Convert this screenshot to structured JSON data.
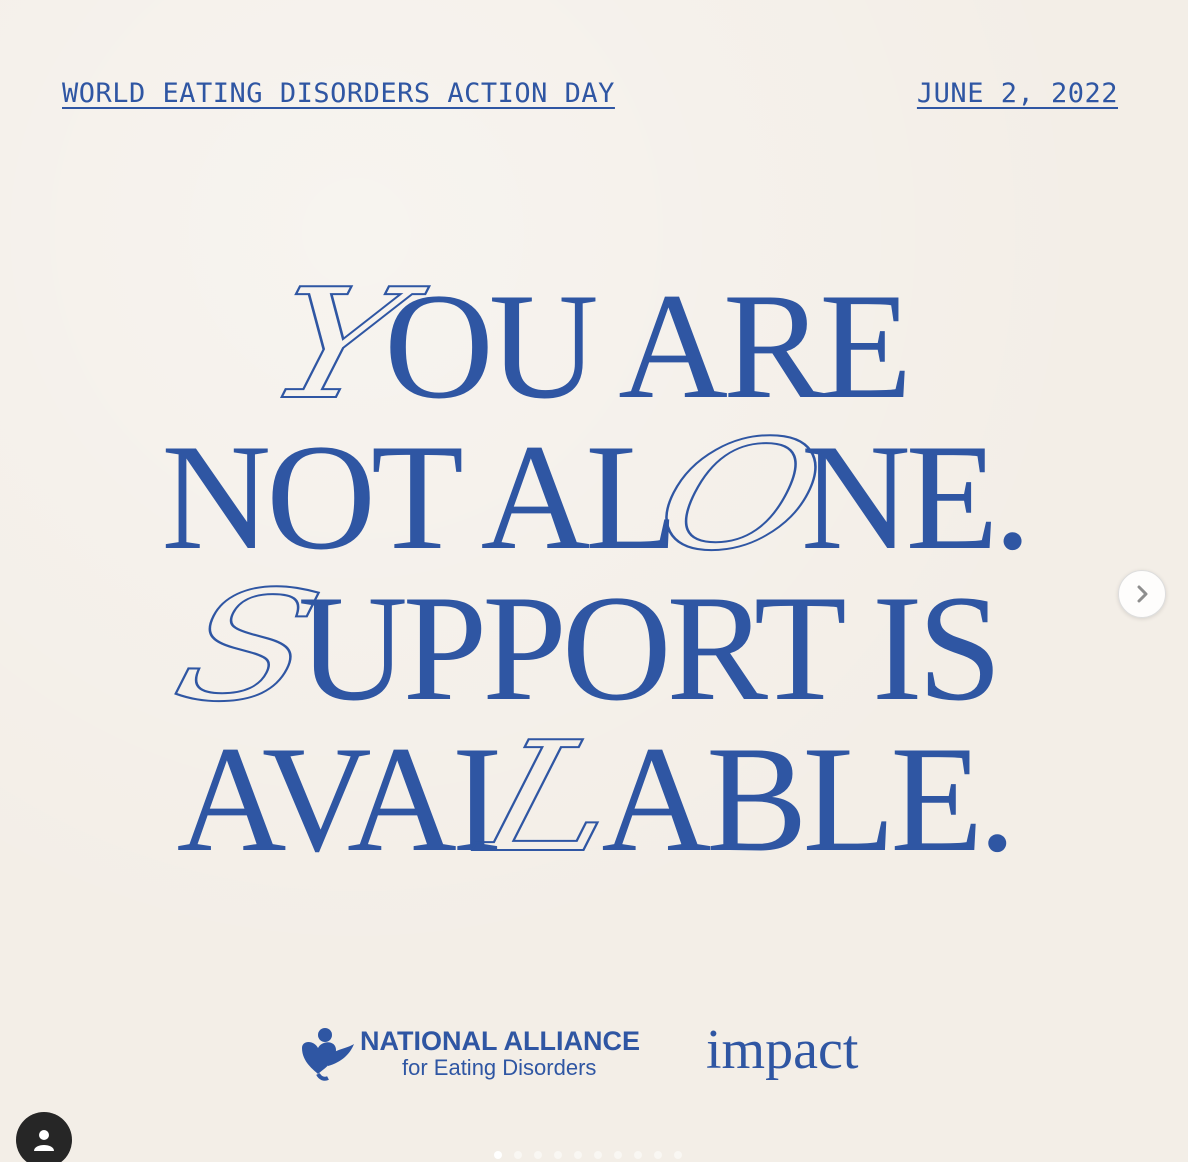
{
  "header": {
    "left_text": "WORLD EATING DISORDERS ACTION DAY",
    "right_text": "JUNE 2, 2022"
  },
  "headline": {
    "line1_script": "Y",
    "line1_rest": "OU ARE",
    "line2_pre": "NOT AL",
    "line2_script": "O",
    "line2_post": "NE.",
    "line3_script": "S",
    "line3_rest": "UPPORT IS",
    "line4_pre": "AVAI",
    "line4_script": "L",
    "line4_post": "ABLE."
  },
  "logos": {
    "national_alliance_line1": "NATIONAL ALLIANCE",
    "national_alliance_line2": "for Eating Disorders",
    "impact": "impact"
  },
  "colors": {
    "brand_blue": "#2f56a3",
    "background": "#f3eee7"
  },
  "controls": {
    "next_icon": "chevron-right-icon",
    "avatar_icon": "user-icon"
  },
  "carousel": {
    "total": 10,
    "active_index": 0
  }
}
